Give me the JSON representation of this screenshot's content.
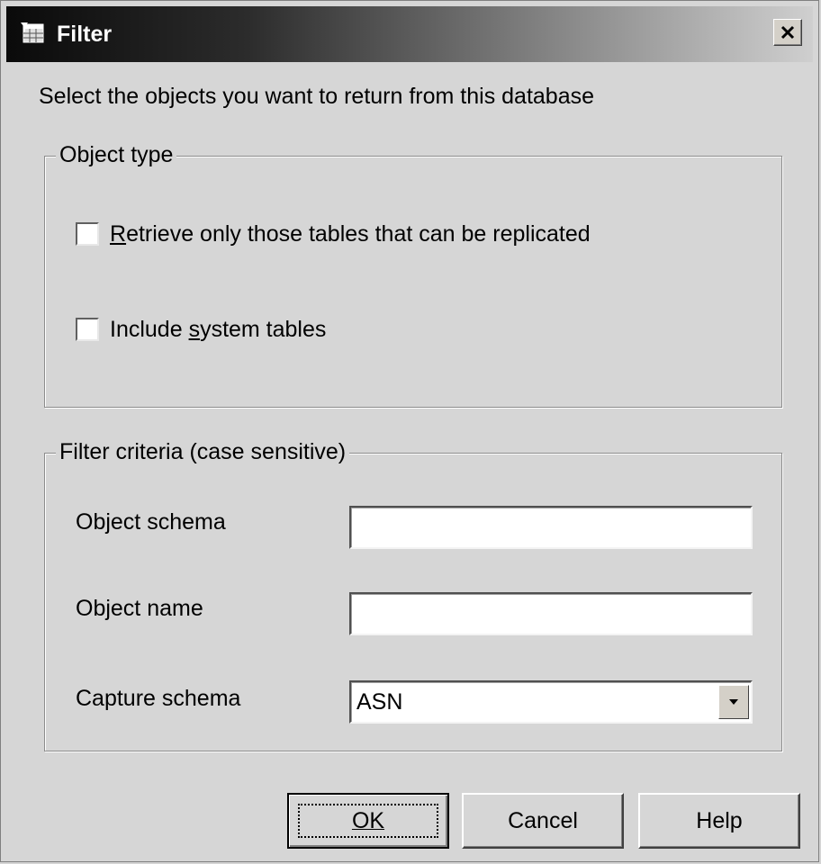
{
  "window": {
    "title": "Filter",
    "icon": "filter-table-icon",
    "close_glyph": "✕"
  },
  "instruction": "Select the objects you want to return from this database",
  "object_type": {
    "legend": "Object type",
    "replicated_checkbox": {
      "label": "Retrieve only those tables that can be replicated",
      "mnemonic": "R",
      "checked": false
    },
    "system_tables_checkbox": {
      "label": "Include system tables",
      "mnemonic": "s",
      "checked": false
    }
  },
  "filter_criteria": {
    "legend": "Filter criteria (case sensitive)",
    "object_schema": {
      "label": "Object schema",
      "value": ""
    },
    "object_name": {
      "label": "Object name",
      "value": ""
    },
    "capture_schema": {
      "label": "Capture schema",
      "value": "ASN"
    }
  },
  "buttons": {
    "ok": "OK",
    "cancel": "Cancel",
    "help": "Help"
  },
  "colors": {
    "dialog_bg": "#d6d6d6",
    "title_bar_start": "#0a0a0a",
    "title_bar_end": "#cfcfcf"
  }
}
